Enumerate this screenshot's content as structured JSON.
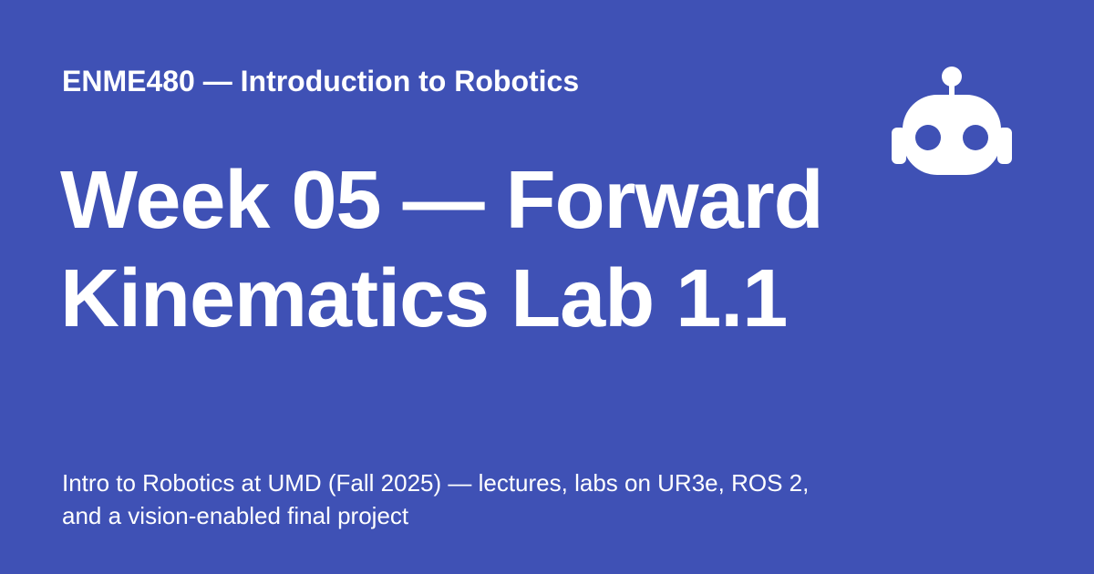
{
  "card": {
    "course_label": "ENME480 — Introduction to Robotics",
    "title": "Week 05 — Forward Kinematics Lab 1.1",
    "description": "Intro to Robotics at UMD (Fall 2025) — lectures, labs on UR3e, ROS 2, and a vision-enabled final project",
    "icon": "robot-icon"
  },
  "colors": {
    "background": "#3f51b5",
    "text": "#ffffff",
    "icon": "#ffffff"
  }
}
